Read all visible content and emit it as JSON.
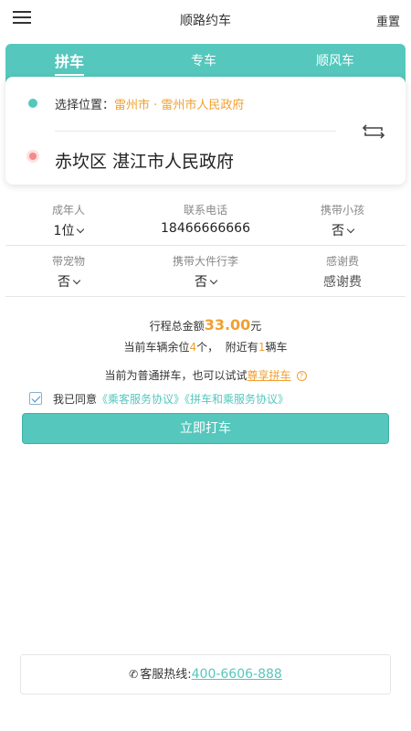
{
  "header": {
    "title": "顺路约车",
    "reset_label": "重置"
  },
  "tabs": [
    {
      "label": "拼车",
      "active": true
    },
    {
      "label": "专车",
      "active": false
    },
    {
      "label": "顺风车",
      "active": false
    }
  ],
  "location": {
    "start_prefix": "选择位置：",
    "start_value": "雷州市 · 雷州市人民政府",
    "end_value": "赤坎区 湛江市人民政府"
  },
  "options": {
    "row1": [
      {
        "label": "成年人",
        "value": "1位"
      },
      {
        "label": "联系电话",
        "value": "18466666666"
      },
      {
        "label": "携带小孩",
        "value": "否"
      }
    ],
    "row2": [
      {
        "label": "带宠物",
        "value": "否"
      },
      {
        "label": "携带大件行李",
        "value": "否"
      },
      {
        "label": "感谢费",
        "value": "感谢费"
      }
    ]
  },
  "summary": {
    "total_prefix": "行程总金额",
    "total_amount": "33.00",
    "total_unit": "元",
    "seats_prefix": "当前车辆余位",
    "seats_count": "4",
    "seats_mid": "个，  附近有",
    "nearby_count": "1",
    "nearby_suffix": "辆车",
    "try_prefix": "当前为普通拼车，也可以试试",
    "try_link": "尊享拼车"
  },
  "agreement": {
    "checked": true,
    "prefix": "我已同意",
    "protocol_1": "《乘客服务协议》",
    "protocol_2": "《拼车和乘服务协议》"
  },
  "actions": {
    "submit_label": "立即打车"
  },
  "footer": {
    "hotline_label": "客服热线:",
    "hotline_number": "400-6606-888"
  },
  "colors": {
    "accent": "#55c7bd",
    "highlight": "#f0a030",
    "end_dot": "#f28b8b"
  },
  "icons": [
    "menu-icon",
    "swap-icon",
    "help-icon",
    "chevron-down-icon",
    "phone-icon",
    "check-icon"
  ]
}
